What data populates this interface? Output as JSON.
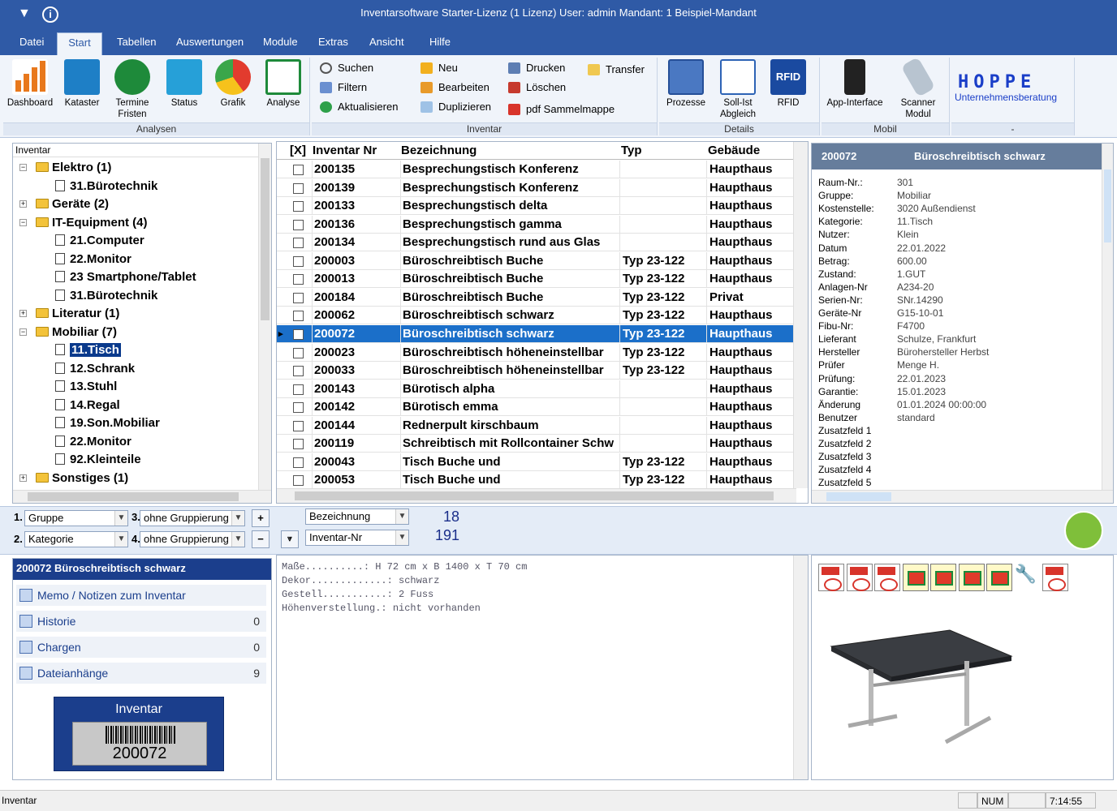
{
  "titlebar": {
    "title": "Inventarsoftware Starter-Lizenz (1 Lizenz)   User: admin   Mandant: 1 Beispiel-Mandant",
    "menu_icon": "dropdown-arrow-icon",
    "info_icon": "info-icon"
  },
  "tabs": [
    "Datei",
    "Start",
    "Tabellen",
    "Auswertungen",
    "Module",
    "Extras",
    "Ansicht",
    "Hilfe"
  ],
  "ribbon": {
    "analysen": {
      "label": "Analysen",
      "buttons": [
        {
          "label": "Dashboard",
          "icon": "dashboard-chart-icon",
          "color": "#e8781c"
        },
        {
          "label": "Kataster",
          "icon": "kataster-icon",
          "color": "#1e7fc6"
        },
        {
          "label": "Termine Fristen",
          "icon": "termine-icon",
          "color": "#1e8a3a"
        },
        {
          "label": "Status",
          "icon": "status-icon",
          "color": "#26a0d8"
        },
        {
          "label": "Grafik",
          "icon": "pie-chart-icon",
          "color": "#e23b2e"
        },
        {
          "label": "Analyse",
          "icon": "analyse-icon",
          "color": "#1e8a3a"
        }
      ]
    },
    "inventar": {
      "label": "Inventar",
      "buttons": [
        {
          "label": "Suchen",
          "icon": "search-icon"
        },
        {
          "label": "Filtern",
          "icon": "filter-icon"
        },
        {
          "label": "Aktualisieren",
          "icon": "refresh-icon"
        },
        {
          "label": "Neu",
          "icon": "new-icon"
        },
        {
          "label": "Bearbeiten",
          "icon": "edit-icon"
        },
        {
          "label": "Duplizieren",
          "icon": "duplicate-icon"
        },
        {
          "label": "Drucken",
          "icon": "print-icon"
        },
        {
          "label": "Löschen",
          "icon": "delete-icon"
        },
        {
          "label": "pdf Sammelmappe",
          "icon": "pdf-icon"
        },
        {
          "label": "Transfer",
          "icon": "transfer-icon"
        }
      ]
    },
    "details": {
      "label": "Details",
      "buttons": [
        {
          "label": "Prozesse",
          "icon": "prozesse-icon"
        },
        {
          "label": "Soll-Ist Abgleich",
          "icon": "soll-ist-icon"
        },
        {
          "label": "RFID",
          "icon": "rfid-icon"
        }
      ]
    },
    "mobil": {
      "label": "Mobil",
      "buttons": [
        {
          "label": "App-Interface",
          "icon": "smartphone-icon"
        },
        {
          "label": "Scanner Modul",
          "icon": "scanner-icon"
        }
      ]
    },
    "hoppe": {
      "label": "-",
      "logo_title": "HOPPE",
      "logo_sub": "Unternehmensberatung"
    }
  },
  "tree": {
    "header": "Inventar",
    "items": [
      {
        "label": "Elektro  (1)",
        "type": "folder",
        "level": 0,
        "expander": "−"
      },
      {
        "label": "31.Bürotechnik",
        "type": "doc",
        "level": 1
      },
      {
        "label": "Geräte  (2)",
        "type": "folder",
        "level": 0,
        "expander": "+"
      },
      {
        "label": "IT-Equipment  (4)",
        "type": "folder",
        "level": 0,
        "expander": "−"
      },
      {
        "label": "21.Computer",
        "type": "doc",
        "level": 1
      },
      {
        "label": "22.Monitor",
        "type": "doc",
        "level": 1
      },
      {
        "label": "23 Smartphone/Tablet",
        "type": "doc",
        "level": 1
      },
      {
        "label": "31.Bürotechnik",
        "type": "doc",
        "level": 1
      },
      {
        "label": "Literatur  (1)",
        "type": "folder",
        "level": 0,
        "expander": "+"
      },
      {
        "label": "Mobiliar  (7)",
        "type": "folder",
        "level": 0,
        "expander": "−"
      },
      {
        "label": "11.Tisch",
        "type": "doc",
        "level": 1,
        "selected": true
      },
      {
        "label": "12.Schrank",
        "type": "doc",
        "level": 1
      },
      {
        "label": "13.Stuhl",
        "type": "doc",
        "level": 1
      },
      {
        "label": "14.Regal",
        "type": "doc",
        "level": 1
      },
      {
        "label": "19.Son.Mobiliar",
        "type": "doc",
        "level": 1
      },
      {
        "label": "22.Monitor",
        "type": "doc",
        "level": 1
      },
      {
        "label": "92.Kleinteile",
        "type": "doc",
        "level": 1
      },
      {
        "label": "Sonstiges  (1)",
        "type": "folder",
        "level": 0,
        "expander": "+"
      }
    ]
  },
  "grid": {
    "columns": [
      "[X]",
      "Inventar Nr",
      "Bezeichnung",
      "Typ",
      "Gebäude"
    ],
    "rows": [
      {
        "nr": "200135",
        "bez": "Besprechungstisch Konferenz",
        "typ": "",
        "geb": "Haupthaus"
      },
      {
        "nr": "200139",
        "bez": "Besprechungstisch Konferenz",
        "typ": "",
        "geb": "Haupthaus"
      },
      {
        "nr": "200133",
        "bez": "Besprechungstisch delta",
        "typ": "",
        "geb": "Haupthaus"
      },
      {
        "nr": "200136",
        "bez": "Besprechungstisch gamma",
        "typ": "",
        "geb": "Haupthaus"
      },
      {
        "nr": "200134",
        "bez": "Besprechungstisch rund aus Glas",
        "typ": "",
        "geb": "Haupthaus"
      },
      {
        "nr": "200003",
        "bez": "Büroschreibtisch  Buche",
        "typ": "Typ 23-122",
        "geb": "Haupthaus"
      },
      {
        "nr": "200013",
        "bez": "Büroschreibtisch  Buche",
        "typ": "Typ 23-122",
        "geb": "Haupthaus"
      },
      {
        "nr": "200184",
        "bez": "Büroschreibtisch  Buche",
        "typ": "Typ 23-122",
        "geb": "Privat"
      },
      {
        "nr": "200062",
        "bez": "Büroschreibtisch  schwarz",
        "typ": "Typ 23-122",
        "geb": "Haupthaus"
      },
      {
        "nr": "200072",
        "bez": "Büroschreibtisch  schwarz",
        "typ": "Typ 23-122",
        "geb": "Haupthaus",
        "selected": true
      },
      {
        "nr": "200023",
        "bez": "Büroschreibtisch höheneinstellbar",
        "typ": "Typ 23-122",
        "geb": "Haupthaus"
      },
      {
        "nr": "200033",
        "bez": "Büroschreibtisch höheneinstellbar",
        "typ": "Typ 23-122",
        "geb": "Haupthaus"
      },
      {
        "nr": "200143",
        "bez": "Bürotisch alpha",
        "typ": "",
        "geb": "Haupthaus"
      },
      {
        "nr": "200142",
        "bez": "Bürotisch emma",
        "typ": "",
        "geb": "Haupthaus"
      },
      {
        "nr": "200144",
        "bez": "Rednerpult kirschbaum",
        "typ": "",
        "geb": "Haupthaus"
      },
      {
        "nr": "200119",
        "bez": "Schreibtisch mit Rollcontainer Schw",
        "typ": "",
        "geb": "Haupthaus"
      },
      {
        "nr": "200043",
        "bez": "Tisch  Buche  und",
        "typ": "Typ 23-122",
        "geb": "Haupthaus"
      },
      {
        "nr": "200053",
        "bez": "Tisch  Buche  und",
        "typ": "Typ 23-122",
        "geb": "Haupthaus"
      }
    ]
  },
  "detail": {
    "id": "200072",
    "title": "Büroschreibtisch  schwarz",
    "fields": [
      {
        "k": "Raum-Nr.:",
        "v": "301"
      },
      {
        "k": "Gruppe:",
        "v": "Mobiliar"
      },
      {
        "k": "Kostenstelle:",
        "v": "3020 Außendienst"
      },
      {
        "k": "Kategorie:",
        "v": "11.Tisch"
      },
      {
        "k": "Nutzer:",
        "v": "Klein"
      },
      {
        "k": "Datum",
        "v": "22.01.2022"
      },
      {
        "k": "Betrag:",
        "v": "600.00"
      },
      {
        "k": "Zustand:",
        "v": "1.GUT"
      },
      {
        "k": "Anlagen-Nr",
        "v": "A234-20"
      },
      {
        "k": "Serien-Nr:",
        "v": "SNr.14290"
      },
      {
        "k": "Geräte-Nr",
        "v": "G15-10-01"
      },
      {
        "k": "Fibu-Nr:",
        "v": "F4700"
      },
      {
        "k": "Lieferant",
        "v": "Schulze, Frankfurt"
      },
      {
        "k": "Hersteller",
        "v": "Bürohersteller Herbst"
      },
      {
        "k": "Prüfer",
        "v": "Menge H."
      },
      {
        "k": "Prüfung:",
        "v": "22.01.2023"
      },
      {
        "k": "Garantie:",
        "v": "15.01.2023"
      },
      {
        "k": "Änderung",
        "v": "01.01.2024 00:00:00"
      },
      {
        "k": "Benutzer",
        "v": "standard"
      },
      {
        "k": "Zusatzfeld 1",
        "v": ""
      },
      {
        "k": "Zusatzfeld 2",
        "v": ""
      },
      {
        "k": "Zusatzfeld 3",
        "v": ""
      },
      {
        "k": "Zusatzfeld 4",
        "v": ""
      },
      {
        "k": "Zusatzfeld 5",
        "v": ""
      }
    ]
  },
  "grouping": {
    "n1": "1.",
    "n2": "2.",
    "n3": "3.",
    "n4": "4.",
    "g1": "Gruppe",
    "g2": "Kategorie",
    "g3": "ohne Gruppierung",
    "g4": "ohne Gruppierung",
    "plus": "+",
    "minus": "−",
    "sort1": "Bezeichnung",
    "sort2": "Inventar-Nr",
    "count1": "18",
    "count2": "191"
  },
  "info": {
    "header": "200072 Büroschreibtisch  schwarz",
    "links": [
      {
        "label": "Memo / Notizen zum Inventar",
        "count": ""
      },
      {
        "label": "Historie",
        "count": "0"
      },
      {
        "label": "Chargen",
        "count": "0"
      },
      {
        "label": "Dateianhänge",
        "count": "9"
      }
    ],
    "barcode_title": "Inventar",
    "barcode_number": "200072"
  },
  "memo": {
    "text": "Maße..........: H 72 cm x B 1400 x T 70 cm\nDekor.............: schwarz\nGestell...........: 2 Fuss\nHöhenverstellung.: nicht vorhanden"
  },
  "attachments": [
    "pdf",
    "pdf",
    "pdf",
    "edit",
    "edit",
    "edit",
    "edit",
    "tool",
    "pdf"
  ],
  "statusbar": {
    "left": "Inventar",
    "num": "NUM",
    "time": "7:14:55"
  }
}
